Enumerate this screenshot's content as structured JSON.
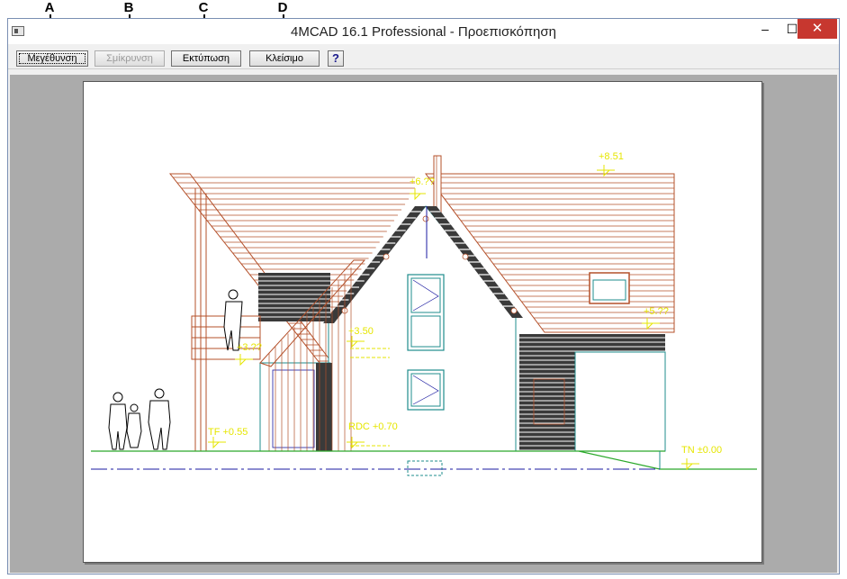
{
  "callouts": [
    "A",
    "B",
    "C",
    "D"
  ],
  "window": {
    "title": "4MCAD 16.1 Professional  - Προεπισκόπηση",
    "controls": {
      "minimize": "–",
      "maximize": "☐",
      "close": "✕"
    }
  },
  "toolbar": {
    "zoom_in_label": "Μεγέθυνση",
    "zoom_out_label": "Σμίκρυνση",
    "print_label": "Εκτύπωση",
    "close_label": "Κλείσιμο",
    "help_label": "?"
  },
  "drawing": {
    "levels": {
      "ridge": "+8.51",
      "top": "+6.??",
      "right_eave": "+5.??",
      "first_floor": "+3.50",
      "balcony": "+3.??",
      "tf": "TF +0.55",
      "rdc": "RDC +0.70",
      "tn": "TN ±0.00"
    },
    "colors": {
      "roof": "#b4502a",
      "wall": "#1f8c8c",
      "ground": "#2aa82a",
      "axis": "#1a1aa0",
      "dark": "#3a3a3a",
      "dimension": "#e6e600"
    }
  }
}
